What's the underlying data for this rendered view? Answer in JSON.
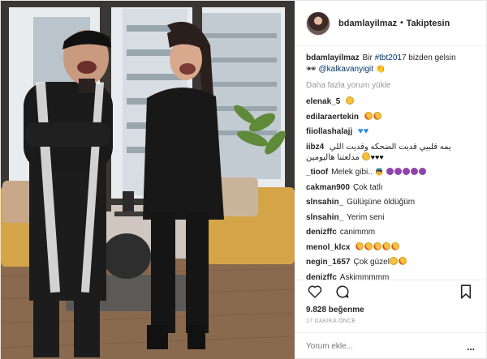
{
  "post": {
    "author": "bdamlayilmaz",
    "follow_status": "Takiptesin",
    "separator": "•",
    "caption_text": "Bir #tbt2017 bizden gelsin",
    "caption_tag": "#tbt2017",
    "caption_mention": "@kalkavanyigit",
    "load_more": "Daha fazla yorum yükle",
    "likes": "9.828 beğenme",
    "time_ago": "17 DAKİKA ÖNCE",
    "comment_placeholder": "Yorum ekle...",
    "more_options": "..."
  },
  "comments": [
    {
      "user": "elenak_5",
      "text": ""
    },
    {
      "user": "edilaraertekin",
      "text": ""
    },
    {
      "user": "fiiollashalajj",
      "text": ""
    },
    {
      "user": "iibz4",
      "text": "يمه قلبيي قديت الضحكه وقديت اللي مدلعتنا هاليومين"
    },
    {
      "user": "_tioof",
      "text": "Melek gibi.."
    },
    {
      "user": "cakman900",
      "text": "Çok tatlı"
    },
    {
      "user": "slnsahin_",
      "text": "Gülüşüne öldüğüm"
    },
    {
      "user": "slnsahin_",
      "text": "Yerim seni"
    },
    {
      "user": "denizffc",
      "text": "canimmm"
    },
    {
      "user": "menol_klcx",
      "text": ""
    },
    {
      "user": "negin_1657",
      "text": "Çok güzel"
    },
    {
      "user": "denizffc",
      "text": "Askimmmmm"
    }
  ],
  "icons": {
    "like": "heart-icon",
    "comment": "comment-icon",
    "save": "bookmark-icon"
  },
  "colors": {
    "link": "#003569",
    "muted": "#999999",
    "text": "#262626"
  }
}
